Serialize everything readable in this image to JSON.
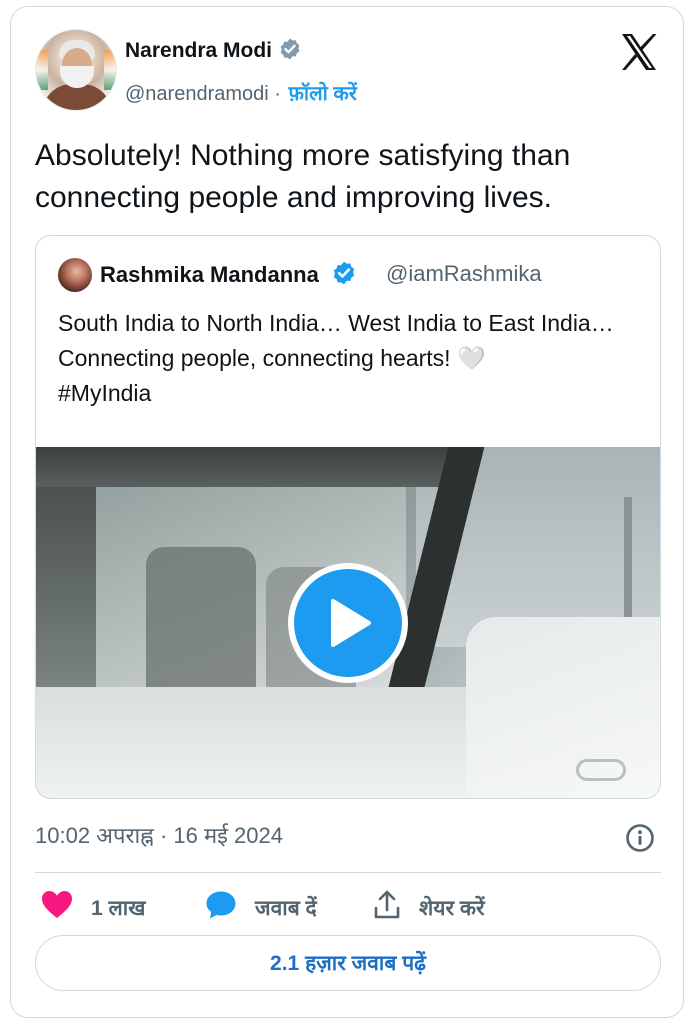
{
  "author": {
    "name": "Narendra Modi",
    "handle": "@narendramodi",
    "separator": "·",
    "follow_label": "फ़ॉलो करें",
    "verified": true
  },
  "tweet": {
    "text": "Absolutely! Nothing more satisfying than connecting people and improving lives."
  },
  "quote": {
    "name": "Rashmika Mandanna",
    "handle": "@iamRashmika",
    "text": "South India to North India… West India to East India… Connecting people, connecting hearts! ",
    "heart": "🤍",
    "hashtag": "#MyIndia"
  },
  "media": {
    "type": "video",
    "play_icon": "play-icon"
  },
  "meta": {
    "timestamp": "10:02 अपराह्न · 16 मई 2024",
    "info_icon": "info-icon"
  },
  "actions": {
    "like_count": "1 लाख",
    "reply_label": "जवाब दें",
    "share_label": "शेयर करें"
  },
  "footer": {
    "read_replies": "2.1 हज़ार जवाब पढ़ें"
  },
  "colors": {
    "accent": "#1d9bf0",
    "like": "#f91880",
    "muted": "#536471",
    "verified_badge": "#829aab",
    "quote_verified_badge": "#1d9bf0"
  }
}
